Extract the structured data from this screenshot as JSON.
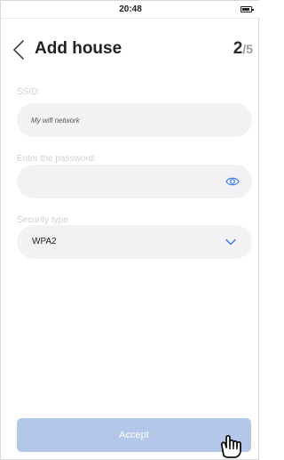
{
  "status_bar": {
    "time": "20:48"
  },
  "header": {
    "back_icon": "chevron-left-icon",
    "title": "Add house",
    "step_current": "2",
    "step_total": "/5"
  },
  "form": {
    "ssid": {
      "label": "SSID:",
      "value": "My wifi network"
    },
    "password": {
      "label": "Enter the password:",
      "value": "",
      "toggle_icon": "eye-icon"
    },
    "security": {
      "label": "Security type",
      "value": "WPA2",
      "icon": "chevron-down-icon"
    }
  },
  "footer": {
    "accept_label": "Accept"
  },
  "colors": {
    "accent": "#3c82dc",
    "button": "#b3c8e8",
    "field": "#f2f2f4",
    "label": "#d0d0d0"
  }
}
